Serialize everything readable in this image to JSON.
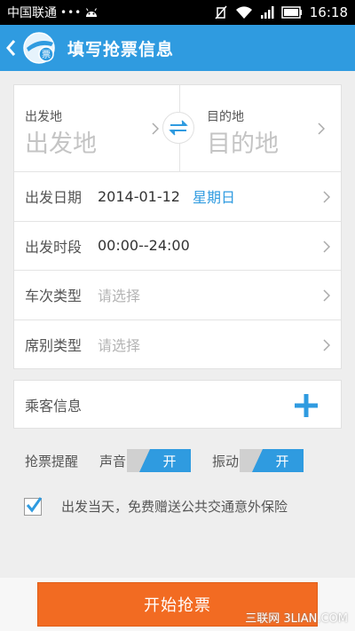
{
  "status_bar": {
    "carrier": "中国联通",
    "dots": "•••",
    "time": "16:18"
  },
  "header": {
    "title": "填写抢票信息",
    "logo_text": "票",
    "brand_color": "#2f9be0"
  },
  "stations": {
    "from_label": "出发地",
    "from_value": "出发地",
    "to_label": "目的地",
    "to_value": "目的地"
  },
  "rows": {
    "date_label": "出发日期",
    "date_value": "2014-01-12",
    "weekday": "星期日",
    "time_label": "出发时段",
    "time_value": "00:00--24:00",
    "train_label": "车次类型",
    "train_placeholder": "请选择",
    "seat_label": "席别类型",
    "seat_placeholder": "请选择"
  },
  "passenger": {
    "label": "乘客信息"
  },
  "reminder": {
    "label": "抢票提醒",
    "sound_label": "声音",
    "sound_state": "开",
    "vibrate_label": "振动",
    "vibrate_state": "开"
  },
  "insurance": {
    "checked": true,
    "text": "出发当天，免费赠送公共交通意外保险"
  },
  "action": {
    "start_label": "开始抢票",
    "accent_color": "#f26b22"
  },
  "watermark": "三联网 3LIAN.COM"
}
